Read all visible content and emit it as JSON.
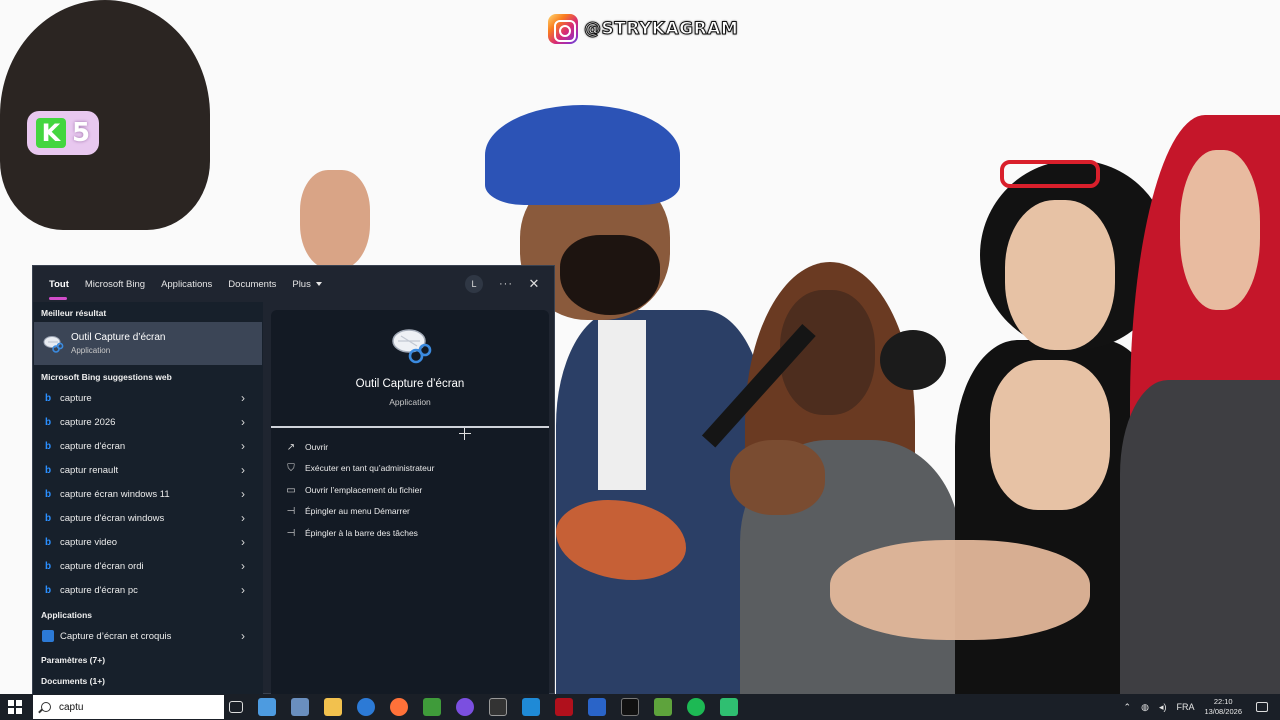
{
  "overlay": {
    "instagram_handle": "@STRYKAGRAM",
    "channel_badge_letter": "K",
    "channel_badge_number": "5"
  },
  "search_panel": {
    "tabs": [
      "Tout",
      "Microsoft Bing",
      "Applications",
      "Documents",
      "Plus"
    ],
    "user_initial": "L",
    "more_label": "···",
    "close_label": "✕",
    "best_result_heading": "Meilleur résultat",
    "best_result": {
      "title": "Outil Capture d’écran",
      "subtitle": "Application"
    },
    "bing_heading": "Microsoft Bing suggestions web",
    "bing_suggestions": [
      "capture",
      "capture 2026",
      "capture d'écran",
      "captur renault",
      "capture écran windows 11",
      "capture d'écran windows",
      "capture video",
      "capture d'écran ordi",
      "capture d'écran pc"
    ],
    "apps_heading": "Applications",
    "apps": [
      "Capture d’écran et croquis"
    ],
    "settings_heading": "Paramètres (7+)",
    "documents_heading": "Documents (1+)",
    "detail": {
      "title": "Outil Capture d’écran",
      "subtitle": "Application",
      "actions": [
        "Ouvrir",
        "Exécuter en tant qu’administrateur",
        "Ouvrir l’emplacement du fichier",
        "Épingler au menu Démarrer",
        "Épingler à la barre des tâches"
      ]
    }
  },
  "taskbar": {
    "search_value": "captu",
    "language": "FRA",
    "time": "22:10",
    "date": "13/08/2026"
  },
  "colors": {
    "accent_tab": "#d24dca",
    "panel_bg": "#1f2530",
    "taskbar_bg": "#1a1f27"
  }
}
